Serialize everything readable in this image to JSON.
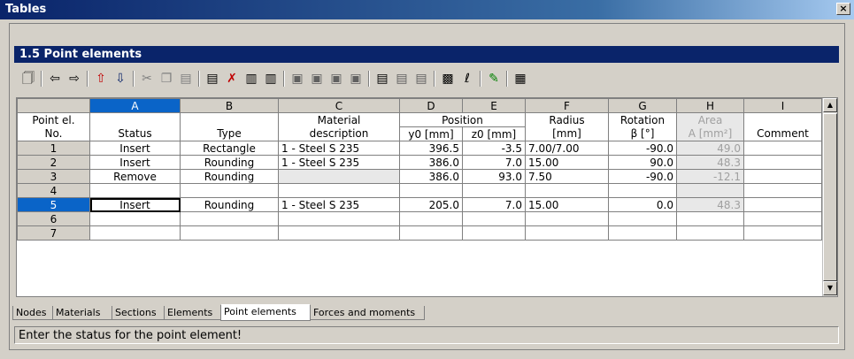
{
  "window": {
    "title": "Tables",
    "close": "×"
  },
  "section": {
    "title": "1.5 Point elements"
  },
  "toolbar": {
    "icons": [
      "properties-icon",
      "arrow-left-icon",
      "arrow-right-icon",
      "export-icon",
      "import-icon",
      "cut-icon",
      "copy-icon",
      "paste-icon",
      "insert-rows-icon",
      "delete-rows-icon",
      "insert-col-icon",
      "append-col-icon",
      "view1-icon",
      "view2-icon",
      "view3-icon",
      "view4-icon",
      "sheet1-icon",
      "sheet2-icon",
      "sheet3-icon",
      "graphic-icon",
      "units-icon",
      "select-icon",
      "calculator-icon"
    ]
  },
  "grid": {
    "col_letters": [
      "A",
      "B",
      "C",
      "D",
      "E",
      "F",
      "G",
      "H",
      "I"
    ],
    "row_header_label_1": "Point el.",
    "row_header_label_2": "No.",
    "header_top": [
      "",
      "",
      "Material",
      "Position",
      "",
      "Radius",
      "Rotation",
      "Area",
      ""
    ],
    "header_bottom": [
      "Status",
      "Type",
      "description",
      "y0 [mm]",
      "z0 [mm]",
      "[mm]",
      "β [°]",
      "A [mm²]",
      "Comment"
    ],
    "rows": [
      {
        "no": "1",
        "status": "Insert",
        "type": "Rectangle",
        "material": "1 - Steel S 235",
        "y0": "396.5",
        "z0": "-3.5",
        "radius": "7.00/7.00",
        "rotation": "-90.0",
        "area": "49.0",
        "comment": ""
      },
      {
        "no": "2",
        "status": "Insert",
        "type": "Rounding",
        "material": "1 - Steel S 235",
        "y0": "386.0",
        "z0": "7.0",
        "radius": "15.00",
        "rotation": "90.0",
        "area": "48.3",
        "comment": ""
      },
      {
        "no": "3",
        "status": "Remove",
        "type": "Rounding",
        "material": "",
        "y0": "386.0",
        "z0": "93.0",
        "radius": "7.50",
        "rotation": "-90.0",
        "area": "-12.1",
        "comment": ""
      },
      {
        "no": "4",
        "status": "",
        "type": "",
        "material": "",
        "y0": "",
        "z0": "",
        "radius": "",
        "rotation": "",
        "area": "",
        "comment": ""
      },
      {
        "no": "5",
        "status": "Insert",
        "type": "Rounding",
        "material": "1 - Steel S 235",
        "y0": "205.0",
        "z0": "7.0",
        "radius": "15.00",
        "rotation": "0.0",
        "area": "48.3",
        "comment": ""
      },
      {
        "no": "6",
        "status": "",
        "type": "",
        "material": "",
        "y0": "",
        "z0": "",
        "radius": "",
        "rotation": "",
        "area": "",
        "comment": ""
      },
      {
        "no": "7",
        "status": "",
        "type": "",
        "material": "",
        "y0": "",
        "z0": "",
        "radius": "",
        "rotation": "",
        "area": "",
        "comment": ""
      }
    ]
  },
  "tabs": [
    "Nodes",
    "Materials",
    "Sections",
    "Elements",
    "Point elements",
    "Forces and moments"
  ],
  "active_tab": "Point elements",
  "status_text": "Enter the status for the point element!"
}
